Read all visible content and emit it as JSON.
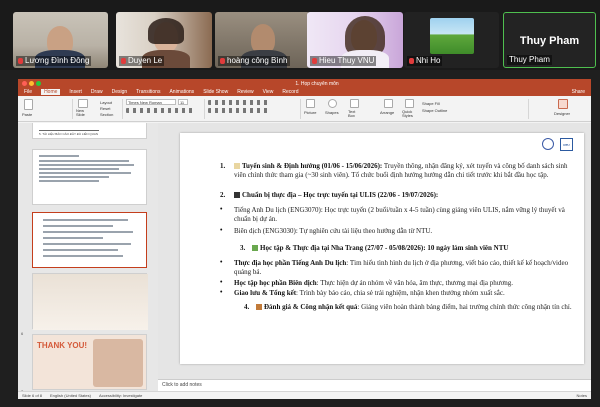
{
  "participants": [
    {
      "name": "Lương Đình Đông"
    },
    {
      "name": "Duyen Le"
    },
    {
      "name": "hoàng công Bình"
    },
    {
      "name": "Hieu Thuy VNU"
    },
    {
      "name": "Nhi Ho"
    },
    {
      "name": "Thuy Pham",
      "display_big": "Thuy Pham"
    }
  ],
  "ppt": {
    "file_title": "1. Họp chuyên môn",
    "menu": [
      "File",
      "Home",
      "Insert",
      "Draw",
      "Design",
      "Transitions",
      "Animations",
      "Slide Show",
      "Review",
      "View",
      "Record"
    ],
    "active_tab": "Home",
    "share": "Share",
    "font_name": "Times New Roman",
    "font_size": "11",
    "ribbon": {
      "paste": "Paste",
      "new_slide": "New Slide",
      "layout": "Layout",
      "reset": "Reset",
      "section": "Section",
      "picture": "Picture",
      "shapes": "Shapes",
      "text_box": "Text Box",
      "arrange": "Arrange",
      "quick_styles": "Quick Styles",
      "shape_fill": "Shape Fill",
      "shape_outline": "Shape Outline",
      "designer": "Designer"
    },
    "thumbnails": [
      "",
      "",
      "",
      "",
      "6",
      "7"
    ],
    "thumb_text": {
      "t2_head": "5. TÀI LIỆU BÁO CÁO ĐẦY ĐỦ LIÊN QUAN",
      "t6_title": "THANK YOU!"
    },
    "notes_placeholder": "Click to add notes",
    "status": {
      "slide": "Slide 6 of 8",
      "language": "English (United States)",
      "accessibility": "Accessibility: Investigate",
      "notes": "Notes"
    }
  },
  "slide": {
    "items": [
      {
        "num": "1.",
        "head": "Tuyển sinh & Định hướng (01/06 - 15/06/2026):",
        "body": " Truyền thông, nhận đăng ký, xét tuyển và công bố danh sách sinh viên chính thức tham gia (~30 sinh viên). Tổ chức buổi định hướng hướng dẫn chi tiết trước khi bắt đầu học tập."
      },
      {
        "num": "2.",
        "head": "Chuẩn bị thực địa – Học trực tuyến tại ULIS (22/06 - 19/07/2026):"
      },
      {
        "bullet": "•",
        "body": "Tiếng Anh Du lịch (ENG3070): Học trực tuyến (2 buổi/tuần x 4-5 tuần) cùng giảng viên ULIS, nắm vững lý thuyết và chuẩn bị dự án."
      },
      {
        "bullet": "•",
        "body": "Biên dịch (ENG3030): Tự nghiên cứu tài liệu theo hướng dẫn từ NTU."
      },
      {
        "num": "3.",
        "head": "Học tập & Thực địa tại Nha Trang (27/07 - 05/08/2026): 10 ngày làm sinh viên NTU"
      },
      {
        "bullet": "•",
        "head": "Thực địa học phần Tiếng Anh Du lịch",
        "body": ": Tìm hiểu tình hình du lịch ở địa phương, viết báo cáo, thiết kế kế hoạch/video quảng bá."
      },
      {
        "bullet": "•",
        "head": "Học tập học phần Biên dịch",
        "body": ": Thực hiện dự án nhóm về văn hóa, âm thực, thương mại địa phương."
      },
      {
        "bullet": "•",
        "head": "Giao lưu & Tổng kết",
        "body": ": Trình bày báo cáo, chia sẻ trải nghiệm, nhận khen thưởng nhóm xuất sắc."
      },
      {
        "num": "4.",
        "head": "Đánh giá & Công nhận kết quả",
        "body": ": Giảng viên hoàn thành bảng điểm, hai trường chính thức công nhận tín chỉ."
      }
    ],
    "logo_text": "NTU"
  },
  "colors": {
    "ppt_accent": "#b7472a",
    "active_speaker": "#4fbf4f"
  }
}
